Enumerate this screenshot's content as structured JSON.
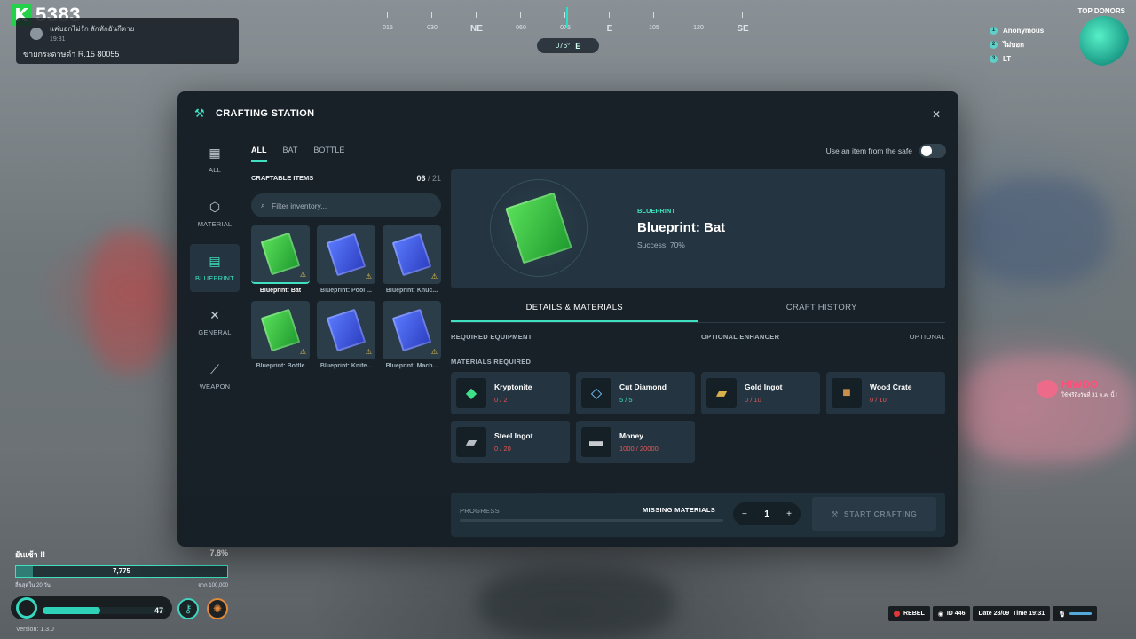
{
  "hud": {
    "logo_letter": "K",
    "logo_number": "5383",
    "notification": {
      "sender": "แค่บอกไม่รัก ลักหักอันกีตาย",
      "time": "19:31",
      "message": "ขายกระดาษดำ R.15 80055"
    },
    "compass": {
      "labels": [
        "015",
        "030",
        "NE",
        "060",
        "075",
        "E",
        "105",
        "120",
        "SE"
      ],
      "heading_value": "076°",
      "heading_dir": "E"
    },
    "donors": {
      "title": "TOP DONORS",
      "names": [
        "Anonymous",
        "ไม่บอก",
        "LT"
      ]
    },
    "ad": {
      "brand": "HIWDO",
      "tagline": "ใช้ฟรีถึงวันที่ 31 ต.ค. นี้ !"
    },
    "xp": {
      "label": "ยันเช้า !!",
      "percent": "7.8%",
      "value": "7,775",
      "left_note": "ลื่นสุดใน 20 วัน",
      "right_note": "จาก 100,000",
      "fill_fraction": 0.078
    },
    "stat": {
      "value": "47",
      "fill_fraction": 0.47
    },
    "version": "Version: 1.3.0",
    "status": {
      "faction": "REBEL",
      "id": "ID 446",
      "date": "Date 28/09",
      "time": "Time 19:31"
    }
  },
  "modal": {
    "title": "CRAFTING STATION",
    "close_icon": "close-icon",
    "categories": [
      {
        "label": "ALL",
        "icon": "grid-icon",
        "glyph": "▦"
      },
      {
        "label": "MATERIAL",
        "icon": "cube-icon",
        "glyph": "⬡"
      },
      {
        "label": "BLUEPRINT",
        "icon": "blueprint-icon",
        "glyph": "▤"
      },
      {
        "label": "GENERAL",
        "icon": "tools-icon",
        "glyph": "✕"
      },
      {
        "label": "WEAPON",
        "icon": "bat-icon",
        "glyph": "⟋"
      }
    ],
    "filter_tabs": [
      "ALL",
      "BAT",
      "BOTTLE"
    ],
    "craftable_label": "CRAFTABLE ITEMS",
    "count_current": "06",
    "count_total": "/ 21",
    "search_placeholder": "Filter inventory...",
    "items": [
      {
        "name": "Blueprint: Bat",
        "color": "green"
      },
      {
        "name": "Blueprint: Pool ...",
        "color": "blue"
      },
      {
        "name": "Blueprint: Knuc...",
        "color": "blue"
      },
      {
        "name": "Blueprint: Bottle",
        "color": "green"
      },
      {
        "name": "Blueprint: Knife...",
        "color": "blue"
      },
      {
        "name": "Blueprint: Mach...",
        "color": "blue"
      }
    ],
    "safe_toggle_label": "Use an item from the safe",
    "selected": {
      "type": "BLUEPRINT",
      "name": "Blueprint: Bat",
      "success": "Success: 70%"
    },
    "detail_tabs": [
      "DETAILS & MATERIALS",
      "CRAFT HISTORY"
    ],
    "required_equipment": "REQUIRED EQUIPMENT",
    "optional_enhancer": "OPTIONAL ENHANCER",
    "optional": "OPTIONAL",
    "materials_required": "MATERIALS REQUIRED",
    "materials": [
      {
        "name": "Kryptonite",
        "qty": "0 / 2",
        "ok": false,
        "icon": "kryptonite-icon",
        "glyph": "◆",
        "color": "#3fe08a"
      },
      {
        "name": "Cut Diamond",
        "qty": "5 / 5",
        "ok": true,
        "icon": "diamond-icon",
        "glyph": "◇",
        "color": "#7ac8ff"
      },
      {
        "name": "Gold Ingot",
        "qty": "0 / 10",
        "ok": false,
        "icon": "gold-ingot-icon",
        "glyph": "▰",
        "color": "#d9b04a"
      },
      {
        "name": "Wood Crate",
        "qty": "0 / 10",
        "ok": false,
        "icon": "crate-icon",
        "glyph": "■",
        "color": "#c8904a"
      },
      {
        "name": "Steel Ingot",
        "qty": "0 / 20",
        "ok": false,
        "icon": "steel-ingot-icon",
        "glyph": "▰",
        "color": "#b8c0c6"
      },
      {
        "name": "Money",
        "qty": "1000 / 20000",
        "ok": false,
        "icon": "money-icon",
        "glyph": "▬",
        "color": "#c8ccd0"
      }
    ],
    "progress_label": "PROGRESS",
    "missing_label": "MISSING MATERIALS",
    "quantity": "1",
    "start_label": "START CRAFTING"
  }
}
